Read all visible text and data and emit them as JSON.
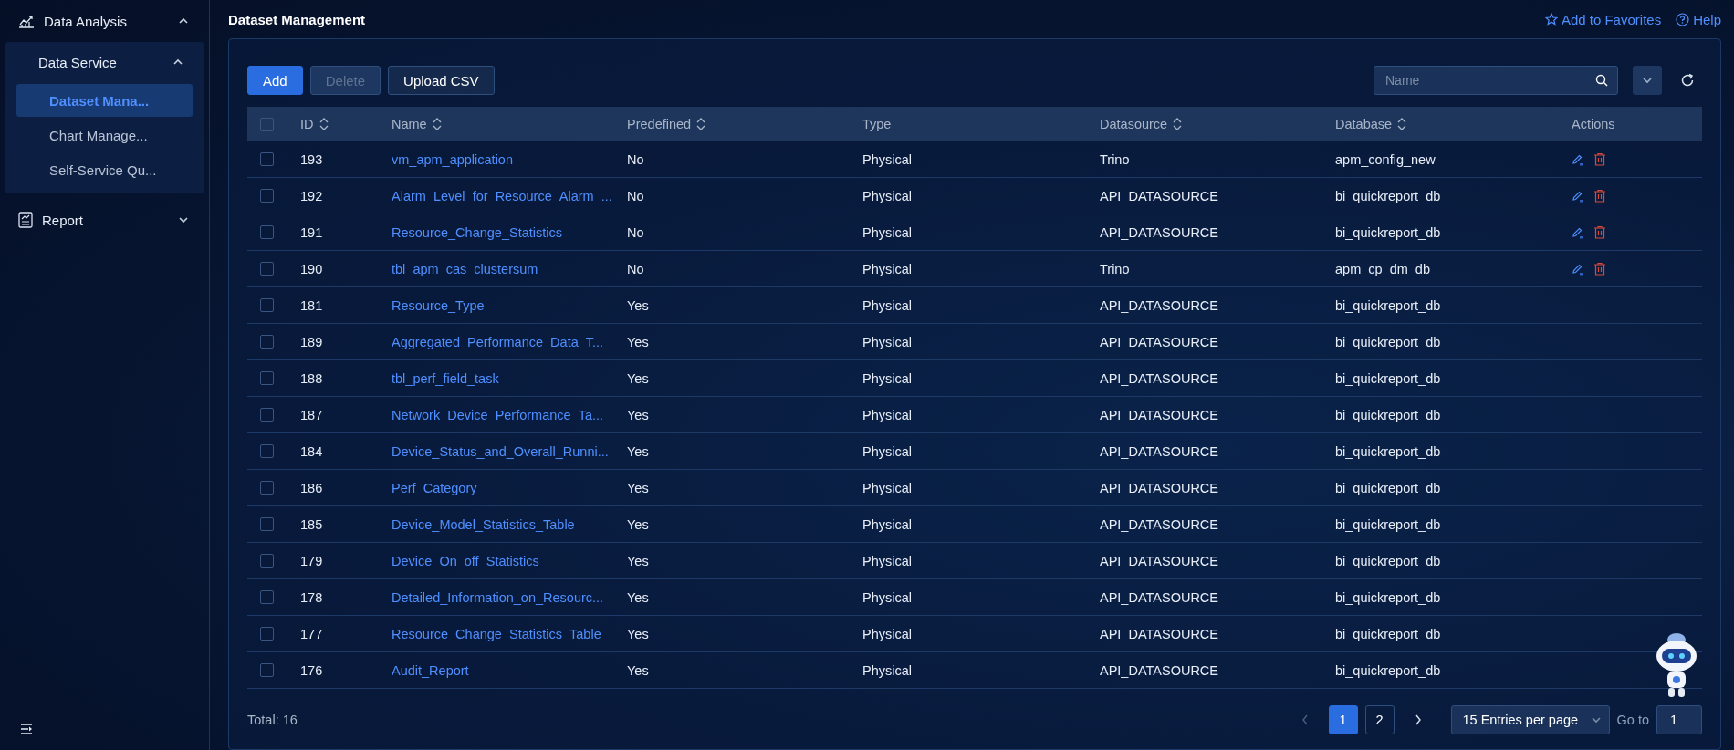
{
  "sidebar": {
    "groups": [
      {
        "label": "Data Analysis",
        "kind": "chart",
        "expanded": true,
        "children": [
          {
            "label": "Data Service",
            "expanded": true,
            "children": [
              {
                "label": "Dataset Mana...",
                "selected": true
              },
              {
                "label": "Chart Manage...",
                "selected": false
              },
              {
                "label": "Self-Service Qu...",
                "selected": false
              }
            ]
          }
        ]
      },
      {
        "label": "Report",
        "kind": "report",
        "expanded": false
      }
    ]
  },
  "page": {
    "title": "Dataset Management",
    "links": [
      {
        "kind": "favorite",
        "label": "Add to Favorites"
      },
      {
        "kind": "help",
        "label": "Help"
      }
    ]
  },
  "toolbar": {
    "buttons": [
      {
        "label": "Add",
        "kind": "primary",
        "disabled": false
      },
      {
        "label": "Delete",
        "kind": "default",
        "disabled": true
      },
      {
        "label": "Upload CSV",
        "kind": "default",
        "disabled": false
      }
    ],
    "search": {
      "placeholder": "Name"
    }
  },
  "table": {
    "all_checked": false,
    "columns": [
      {
        "label": "ID",
        "sortable": true
      },
      {
        "label": "Name",
        "sortable": true
      },
      {
        "label": "Predefined",
        "sortable": true
      },
      {
        "label": "Type",
        "sortable": false
      },
      {
        "label": "Datasource",
        "sortable": true
      },
      {
        "label": "Database",
        "sortable": true
      },
      {
        "label": "Actions",
        "sortable": false
      }
    ],
    "rows": [
      {
        "checked": false,
        "id": "193",
        "name": "vm_apm_application",
        "predefined": "No",
        "type": "Physical",
        "datasource": "Trino",
        "database": "apm_config_new",
        "editable": true
      },
      {
        "checked": false,
        "id": "192",
        "name": "Alarm_Level_for_Resource_Alarm_...",
        "predefined": "No",
        "type": "Physical",
        "datasource": "API_DATASOURCE",
        "database": "bi_quickreport_db",
        "editable": true
      },
      {
        "checked": false,
        "id": "191",
        "name": "Resource_Change_Statistics",
        "predefined": "No",
        "type": "Physical",
        "datasource": "API_DATASOURCE",
        "database": "bi_quickreport_db",
        "editable": true
      },
      {
        "checked": false,
        "id": "190",
        "name": "tbl_apm_cas_clustersum",
        "predefined": "No",
        "type": "Physical",
        "datasource": "Trino",
        "database": "apm_cp_dm_db",
        "editable": true
      },
      {
        "checked": false,
        "id": "181",
        "name": "Resource_Type",
        "predefined": "Yes",
        "type": "Physical",
        "datasource": "API_DATASOURCE",
        "database": "bi_quickreport_db",
        "editable": false
      },
      {
        "checked": false,
        "id": "189",
        "name": "Aggregated_Performance_Data_T...",
        "predefined": "Yes",
        "type": "Physical",
        "datasource": "API_DATASOURCE",
        "database": "bi_quickreport_db",
        "editable": false
      },
      {
        "checked": false,
        "id": "188",
        "name": "tbl_perf_field_task",
        "predefined": "Yes",
        "type": "Physical",
        "datasource": "API_DATASOURCE",
        "database": "bi_quickreport_db",
        "editable": false
      },
      {
        "checked": false,
        "id": "187",
        "name": "Network_Device_Performance_Ta...",
        "predefined": "Yes",
        "type": "Physical",
        "datasource": "API_DATASOURCE",
        "database": "bi_quickreport_db",
        "editable": false
      },
      {
        "checked": false,
        "id": "184",
        "name": "Device_Status_and_Overall_Runni...",
        "predefined": "Yes",
        "type": "Physical",
        "datasource": "API_DATASOURCE",
        "database": "bi_quickreport_db",
        "editable": false
      },
      {
        "checked": false,
        "id": "186",
        "name": "Perf_Category",
        "predefined": "Yes",
        "type": "Physical",
        "datasource": "API_DATASOURCE",
        "database": "bi_quickreport_db",
        "editable": false
      },
      {
        "checked": false,
        "id": "185",
        "name": "Device_Model_Statistics_Table",
        "predefined": "Yes",
        "type": "Physical",
        "datasource": "API_DATASOURCE",
        "database": "bi_quickreport_db",
        "editable": false
      },
      {
        "checked": false,
        "id": "179",
        "name": "Device_On_off_Statistics",
        "predefined": "Yes",
        "type": "Physical",
        "datasource": "API_DATASOURCE",
        "database": "bi_quickreport_db",
        "editable": false
      },
      {
        "checked": false,
        "id": "178",
        "name": "Detailed_Information_on_Resourc...",
        "predefined": "Yes",
        "type": "Physical",
        "datasource": "API_DATASOURCE",
        "database": "bi_quickreport_db",
        "editable": false
      },
      {
        "checked": false,
        "id": "177",
        "name": "Resource_Change_Statistics_Table",
        "predefined": "Yes",
        "type": "Physical",
        "datasource": "API_DATASOURCE",
        "database": "bi_quickreport_db",
        "editable": false
      },
      {
        "checked": false,
        "id": "176",
        "name": "Audit_Report",
        "predefined": "Yes",
        "type": "Physical",
        "datasource": "API_DATASOURCE",
        "database": "bi_quickreport_db",
        "editable": false
      }
    ]
  },
  "footer": {
    "total": "Total: 16",
    "pages": [
      {
        "label": "1",
        "selected": true
      },
      {
        "label": "2",
        "selected": false
      }
    ],
    "page_size": "15 Entries per page",
    "goto_label": "Go to",
    "goto_value": "1"
  }
}
